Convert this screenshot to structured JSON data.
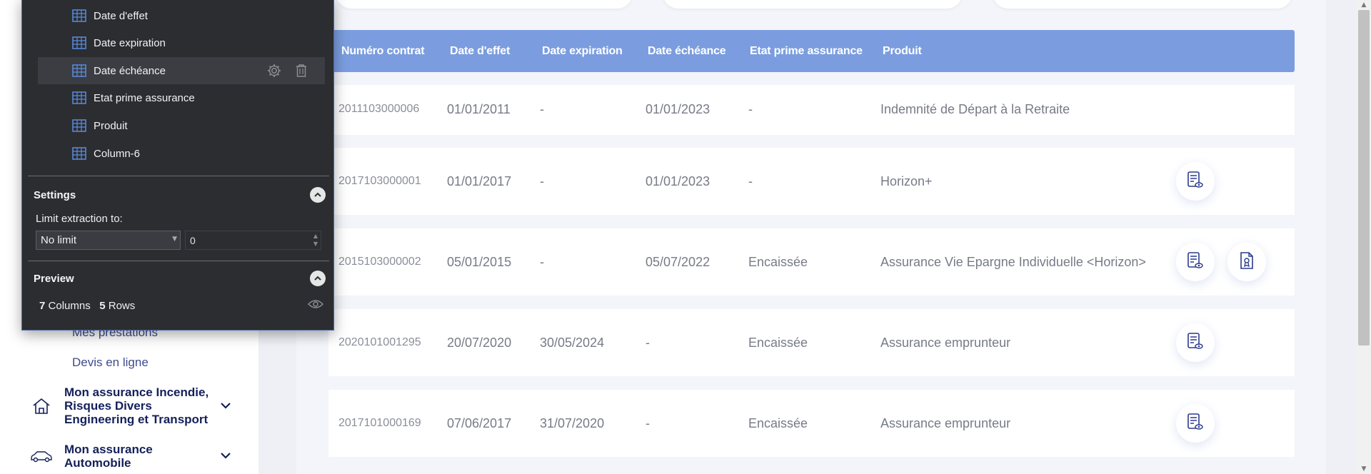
{
  "sidebar": {
    "sub_links": [
      "Mes prestations",
      "Devis en ligne"
    ],
    "groups": [
      {
        "label": "Mon assurance Incendie, Risques Divers Engineering et Transport",
        "icon": "home-icon"
      },
      {
        "label": "Mon assurance Automobile",
        "icon": "car-icon"
      }
    ]
  },
  "table": {
    "headers": [
      "Numéro contrat",
      "Date d'effet",
      "Date expiration",
      "Date échéance",
      "Etat prime assurance",
      "Produit"
    ],
    "rows": [
      {
        "numero": "2011103000006",
        "effet": "01/01/2011",
        "expiration": "-",
        "echeance": "01/01/2023",
        "etat": "-",
        "produit": "Indemnité de Départ à la Retraite",
        "actions": []
      },
      {
        "numero": "2017103000001",
        "effet": "01/01/2017",
        "expiration": "-",
        "echeance": "01/01/2023",
        "etat": "-",
        "produit": "Horizon+",
        "actions": [
          "view-document-icon"
        ]
      },
      {
        "numero": "2015103000002",
        "effet": "05/01/2015",
        "expiration": "-",
        "echeance": "05/07/2022",
        "etat": "Encaissée",
        "produit": "Assurance Vie Epargne Individuelle <Horizon>",
        "actions": [
          "view-document-icon",
          "certificate-document-icon"
        ]
      },
      {
        "numero": "2020101001295",
        "effet": "20/07/2020",
        "expiration": "30/05/2024",
        "echeance": "-",
        "etat": "Encaissée",
        "produit": "Assurance emprunteur",
        "actions": [
          "view-document-icon"
        ]
      },
      {
        "numero": "2017101000169",
        "effet": "07/06/2017",
        "expiration": "31/07/2020",
        "echeance": "-",
        "etat": "Encaissée",
        "produit": "Assurance emprunteur",
        "actions": [
          "view-document-icon"
        ]
      }
    ]
  },
  "extraction_panel": {
    "columns": [
      "Date d'effet",
      "Date expiration",
      "Date échéance",
      "Etat prime assurance",
      "Produit",
      "Column-6"
    ],
    "selected_column": "Date échéance",
    "settings": {
      "title": "Settings",
      "limit_label": "Limit extraction to:",
      "limit_option": "No limit",
      "limit_value": "0"
    },
    "preview": {
      "title": "Preview",
      "columns_count": "7",
      "columns_word": "Columns",
      "rows_count": "5",
      "rows_word": "Rows"
    }
  },
  "colors": {
    "header_blue": "#7b9ddf",
    "panel_dark": "#2b2d31",
    "nav_text": "#14205a",
    "link_text": "#3d4b8c"
  }
}
